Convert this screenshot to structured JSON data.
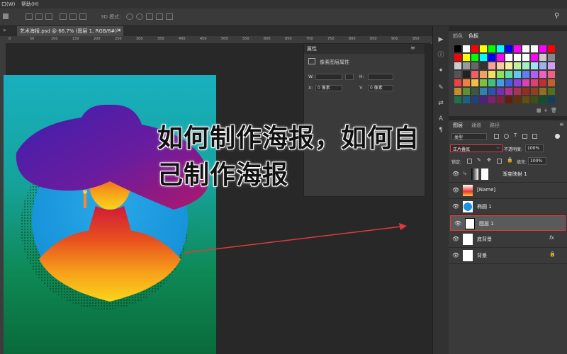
{
  "menu": {
    "items": [
      "口(W)",
      "帮助(H)"
    ]
  },
  "options_bar": {
    "mode_label": "3D 模式:"
  },
  "document_tab": {
    "label": "艺术海报.psd @ 66.7% (图层 1, RGB/8#) *",
    "close": "×"
  },
  "ruler": {
    "ticks": [
      "0",
      "50",
      "100",
      "150",
      "200",
      "250",
      "300",
      "350",
      "400",
      "450",
      "500",
      "550",
      "600",
      "650",
      "700",
      "750",
      "800",
      "850",
      "900",
      "950"
    ]
  },
  "properties": {
    "tab": "属性",
    "subtitle": "像素图层属性",
    "w_label": "W:",
    "h_label": "H:",
    "x_label": "X:",
    "x_value": "0 像素",
    "y_label": "Y:",
    "y_value": "0 像素"
  },
  "swatches": {
    "tabs": [
      "颜色",
      "色板"
    ],
    "colors": [
      "#000000",
      "#ffffff",
      "#ff0000",
      "#ffff00",
      "#00ff00",
      "#00ffff",
      "#0000ff",
      "#ff00ff",
      "#ffffff",
      "#ffffff",
      "#ff00ff",
      "#ff0000",
      "#ff0000",
      "#ffff00",
      "#00ff00",
      "#00ffff",
      "#0000ff",
      "#ff00ff",
      "#ffffff",
      "#ffffff",
      "#ffffff",
      "#ff00ff",
      "#cccccc",
      "#888888",
      "#cccccc",
      "#999999",
      "#666666",
      "#333333",
      "#f8a0a0",
      "#f8c8a0",
      "#f8f0a0",
      "#c0f0a0",
      "#a0f0c8",
      "#a0e0f0",
      "#a0b0f0",
      "#d0a0f0",
      "#555555",
      "#222222",
      "#f06060",
      "#f0a060",
      "#f0e060",
      "#90e060",
      "#60e0a0",
      "#60c8f0",
      "#6080f0",
      "#b060f0",
      "#f060c0",
      "#f06080",
      "#f04040",
      "#f08040",
      "#f0c040",
      "#80c040",
      "#40c080",
      "#40a0e0",
      "#4060e0",
      "#9040e0",
      "#e040b0",
      "#e04070",
      "#c03030",
      "#c06030",
      "#c09030",
      "#609030",
      "#30906060",
      "#3080b0",
      "#3050b0",
      "#7030b0",
      "#b03090",
      "#b03050",
      "#903020",
      "#904020",
      "#907020",
      "#507020",
      "#207050",
      "#206080",
      "#204080",
      "#502080",
      "#802070",
      "#802040",
      "#602010",
      "#603010",
      "#605010",
      "#405010",
      "#105030",
      "#104060"
    ],
    "footer_icons": [
      "folder-icon",
      "add-icon",
      "delete-icon"
    ]
  },
  "layers": {
    "tabs": [
      "图层",
      "通道",
      "路径"
    ],
    "kind_label": "类型",
    "blend_mode": "正片叠底",
    "opacity_label": "不透明度:",
    "opacity_value": "100%",
    "lock_label": "锁定:",
    "fill_label": "填充:",
    "fill_value": "100%",
    "items": [
      {
        "name": "渐变映射 1",
        "visible": true,
        "selected": false
      },
      {
        "name": "[Name]",
        "visible": true,
        "selected": false
      },
      {
        "name": "椭圆 1",
        "visible": true,
        "selected": false
      },
      {
        "name": "图层 1",
        "visible": true,
        "selected": true
      },
      {
        "name": "底背景",
        "visible": true,
        "selected": false,
        "fx": "fx"
      },
      {
        "name": "背景",
        "visible": true,
        "selected": false,
        "locked": true
      }
    ]
  },
  "overlay": {
    "title": "如何制作海报，如何自己制作海报"
  },
  "colors": {
    "annotation": "#e03a3a",
    "ps_bg": "#282828",
    "panel": "#3a3a3a"
  }
}
